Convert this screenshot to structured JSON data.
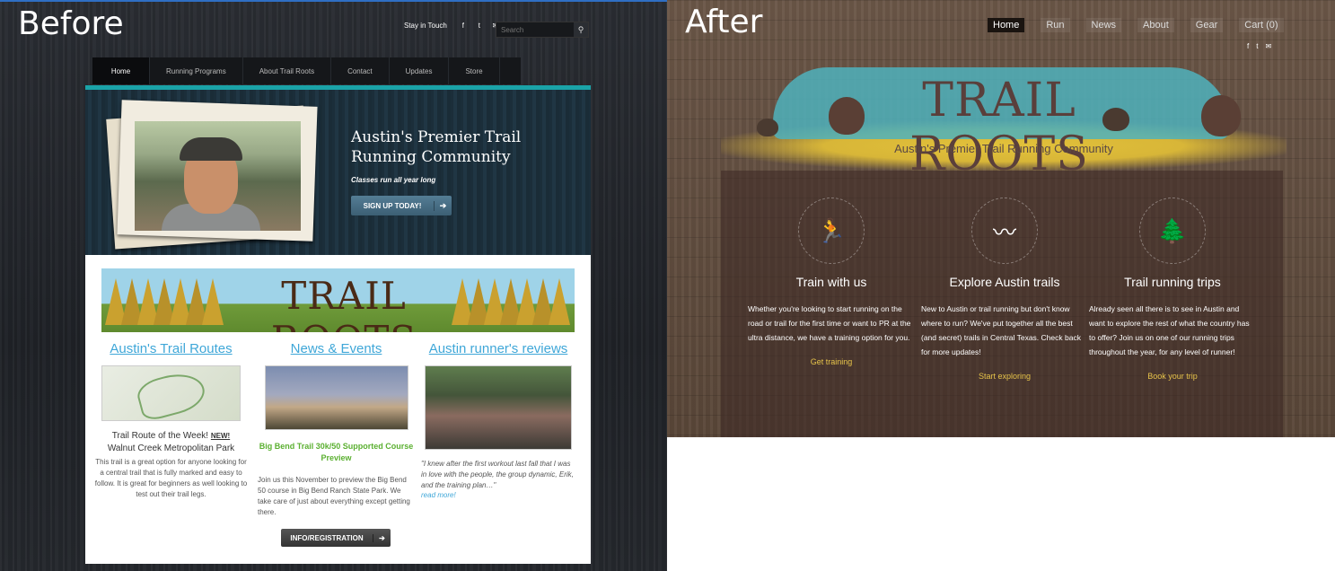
{
  "labels": {
    "before": "Before",
    "after": "After"
  },
  "before": {
    "stay_in_touch": "Stay in Touch",
    "social": [
      "f",
      "t",
      "✉"
    ],
    "search_placeholder": "Search",
    "nav": [
      "Home",
      "Running Programs",
      "About Trail Roots",
      "Contact",
      "Updates",
      "Store"
    ],
    "hero": {
      "title_line1": "Austin's Premier Trail",
      "title_line2": "Running Community",
      "subtitle": "Classes run all year long",
      "cta": "SIGN UP TODAY!"
    },
    "banner_logo": "TRAIL ROOTS",
    "columns": [
      {
        "heading": "Austin's Trail Routes",
        "title": "Trail Route of the Week!",
        "badge": "NEW!",
        "place": "Walnut Creek Metropolitan Park",
        "text": "This trail is a great option for anyone looking for a central trail that is fully marked and easy to follow. It is great for beginners as well looking to test out their trail legs."
      },
      {
        "heading": "News & Events",
        "title": "Big Bend Trail 30k/50 Supported Course Preview",
        "text": "Join us this November to preview the Big Bend 50 course in Big Bend Ranch State Park. We take care of just about everything except getting there.",
        "cta": "INFO/REGISTRATION"
      },
      {
        "heading": "Austin runner's reviews",
        "quote": "\"I knew after the first workout last fall that I was in love with the people, the group dynamic, Erik, and the training plan…\"",
        "link": "read more!"
      }
    ]
  },
  "after": {
    "nav": [
      "Home",
      "Run",
      "News",
      "About",
      "Gear",
      "Cart (0)"
    ],
    "social": [
      "f",
      "t",
      "✉"
    ],
    "logo": "TRAIL ROOTS",
    "tagline": "Austin's Premier Trail Running Community",
    "features": [
      {
        "title": "Train with us",
        "text": "Whether you're looking to start running on the road or trail for the first time or want to PR at the ultra distance, we have a training option for you.",
        "link": "Get training"
      },
      {
        "title": "Explore Austin trails",
        "text": "New to Austin or trail running but don't know where to run? We've put together all the best (and secret) trails in Central Texas. Check back for more updates!",
        "link": "Start exploring"
      },
      {
        "title": "Trail running trips",
        "text": "Already seen all there is to see in Austin and want to explore the rest of what the country has to offer? Join us on one of our running trips throughout the year, for any level of runner!",
        "link": "Book your trip"
      }
    ]
  }
}
